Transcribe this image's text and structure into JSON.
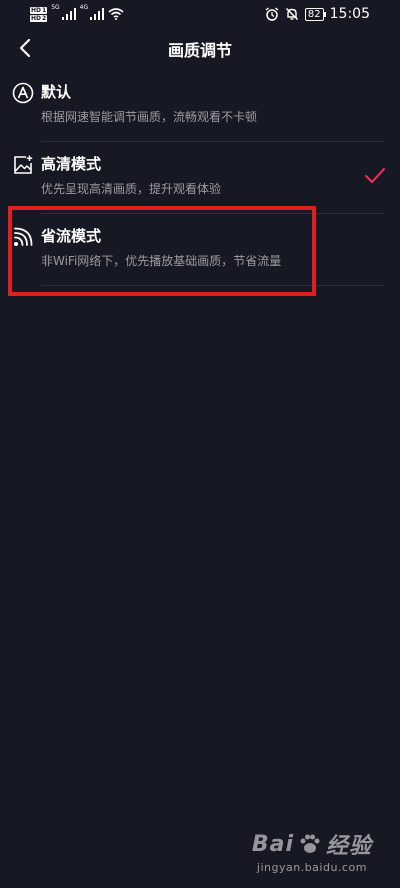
{
  "status_bar": {
    "sim1_label": "HD",
    "sim1_slot": "1",
    "sim2_label": "HD",
    "sim2_slot": "2",
    "signal1_type": "5G",
    "signal2_type": "4G",
    "battery": "82",
    "time": "15:05",
    "icons": [
      "signal-icon",
      "wifi-icon",
      "alarm-icon",
      "mute-icon",
      "battery-icon"
    ]
  },
  "nav": {
    "title": "画质调节",
    "back_icon": "chevron-left-icon"
  },
  "options": [
    {
      "icon": "letter-a-circle-icon",
      "title": "默认",
      "desc": "根据网速智能调节画质，流畅观看不卡顿",
      "selected": false
    },
    {
      "icon": "image-hd-icon",
      "title": "高清模式",
      "desc": "优先呈现高清画质，提升观看体验",
      "selected": true
    },
    {
      "icon": "data-saver-icon",
      "title": "省流模式",
      "desc": "非WiFi网络下，优先播放基础画质，节省流量",
      "selected": false,
      "highlighted": true
    }
  ],
  "colors": {
    "background": "#161823",
    "check": "#fe2c55",
    "highlight": "#e02020",
    "desc_text": "#9b9ca3"
  },
  "watermark": {
    "logo_text": "Bai",
    "logo_suffix": "经验",
    "url": "jingyan.baidu.com"
  }
}
